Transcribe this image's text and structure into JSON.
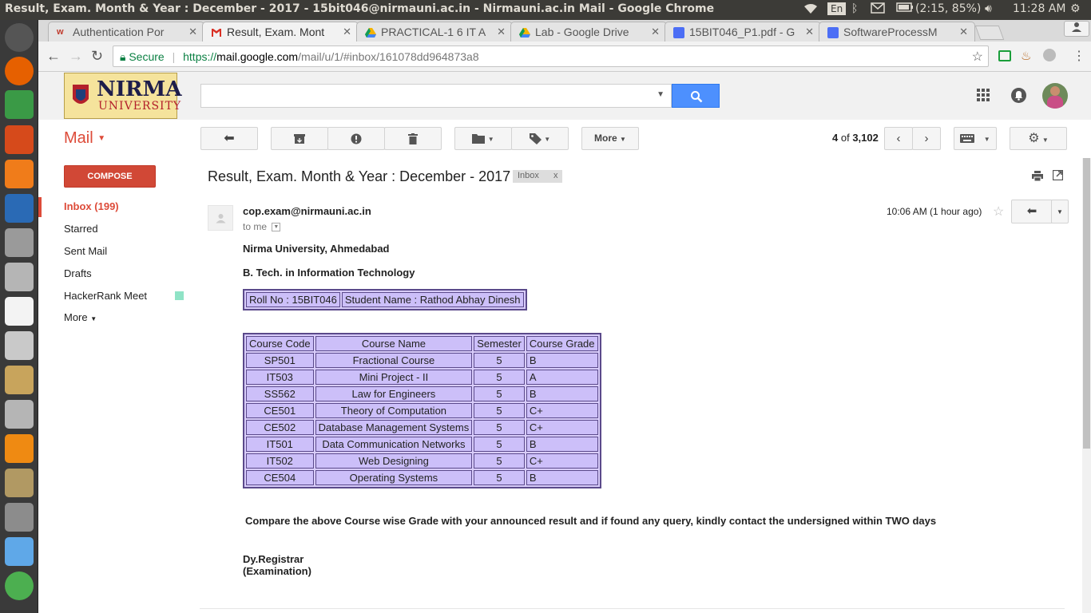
{
  "os": {
    "window_title": "Result, Exam. Month & Year : December - 2017 - 15bit046@nirmauni.ac.in - Nirmauni.ac.in Mail - Google Chrome",
    "kb_layout": "En",
    "battery": "(2:15, 85%)",
    "clock": "11:28 AM"
  },
  "browser": {
    "tabs": [
      {
        "label": "Authentication Por"
      },
      {
        "label": "Result, Exam. Mont"
      },
      {
        "label": "PRACTICAL-1 6 IT A"
      },
      {
        "label": "Lab - Google Drive"
      },
      {
        "label": "15BIT046_P1.pdf - G"
      },
      {
        "label": "SoftwareProcessM"
      }
    ],
    "secure_label": "Secure",
    "url_prefix": "https://",
    "url_host": "mail.google.com",
    "url_path": "/mail/u/1/#inbox/161078dd964873a8"
  },
  "logo": {
    "line1": "NIRMA",
    "line2": "UNIVERSITY"
  },
  "gmail": {
    "mail_label": "Mail",
    "toolbar": {
      "more_label": "More",
      "count_current": "4",
      "count_of": "of",
      "count_total": "3,102"
    },
    "compose_label": "COMPOSE",
    "nav": [
      {
        "label": "Inbox (199)"
      },
      {
        "label": "Starred"
      },
      {
        "label": "Sent Mail"
      },
      {
        "label": "Drafts"
      },
      {
        "label": "HackerRank Meet"
      },
      {
        "label": "More"
      }
    ],
    "label_color": "#8fe3c6"
  },
  "email": {
    "subject": "Result, Exam. Month & Year : December - 2017",
    "label_chip": "Inbox",
    "label_chip_close": "x",
    "sender": "cop.exam@nirmauni.ac.in",
    "to": "to me",
    "time": "10:06 AM (1 hour ago)",
    "line_university": "Nirma University, Ahmedabad",
    "line_program": "B. Tech. in Information Technology",
    "roll": "Roll No : 15BIT046",
    "student": "Student Name : Rathod Abhay Dinesh",
    "headers": [
      "Course Code",
      "Course Name",
      "Semester",
      "Course Grade"
    ],
    "rows": [
      [
        "SP501",
        "Fractional Course",
        "5",
        "B"
      ],
      [
        "IT503",
        "Mini Project - II",
        "5",
        "A"
      ],
      [
        "SS562",
        "Law for Engineers",
        "5",
        "B"
      ],
      [
        "CE501",
        "Theory of Computation",
        "5",
        "C+"
      ],
      [
        "CE502",
        "Database Management Systems",
        "5",
        "C+"
      ],
      [
        "IT501",
        "Data Communication Networks",
        "5",
        "B"
      ],
      [
        "IT502",
        "Web Designing",
        "5",
        "C+"
      ],
      [
        "CE504",
        "Operating Systems",
        "5",
        "B"
      ]
    ],
    "note": "Compare the above Course wise Grade with your announced result and if found any query, kindly contact the undersigned within TWO days",
    "sig1": "Dy.Registrar",
    "sig2": "(Examination)"
  },
  "colors": {
    "accent_red": "#dd4b39",
    "search_blue": "#4d90fe",
    "table_fill": "#ccbff9",
    "table_border": "#5b4a8b"
  }
}
